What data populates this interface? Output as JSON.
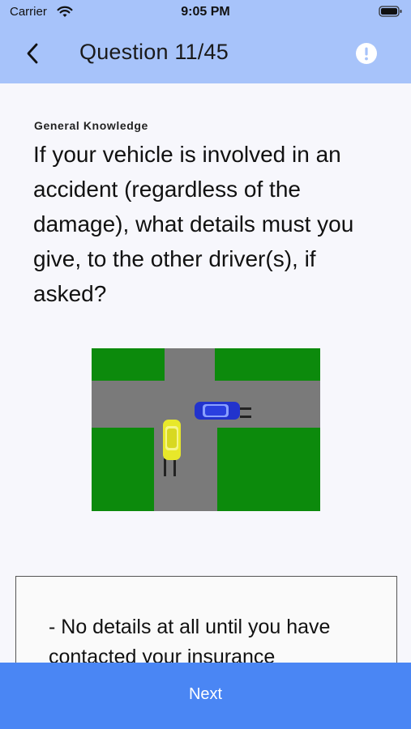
{
  "status_bar": {
    "carrier": "Carrier",
    "time": "9:05 PM"
  },
  "header": {
    "title": "Question 11/45",
    "background": "#a7c3fa"
  },
  "question": {
    "category": "General Knowledge",
    "text": "If your vehicle is involved in an accident (regardless of the damage), what details must you give, to the other driver(s), if asked?"
  },
  "answers": [
    {
      "label": "- No details at all until you have contacted your insurance"
    }
  ],
  "footer": {
    "next_label": "Next",
    "accent": "#4a86f4"
  }
}
